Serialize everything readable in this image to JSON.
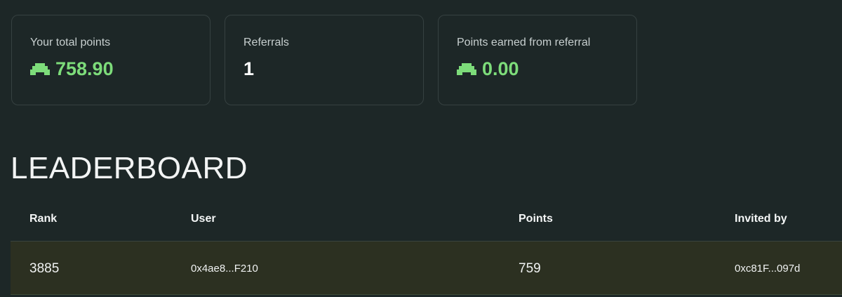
{
  "stats": [
    {
      "label": "Your total points",
      "value": "758.90",
      "icon": "points-icon",
      "color": "#7ddc7a"
    },
    {
      "label": "Referrals",
      "value": "1"
    },
    {
      "label": "Points earned from referral",
      "value": "0.00",
      "icon": "points-icon",
      "color": "#7ddc7a"
    }
  ],
  "leaderboard": {
    "title": "LEADERBOARD",
    "columns": [
      "Rank",
      "User",
      "Points",
      "Invited by"
    ],
    "rows": [
      {
        "rank": "3885",
        "user": "0x4ae8...F210",
        "points": "759",
        "invited_by": "0xc81F...097d"
      }
    ]
  }
}
